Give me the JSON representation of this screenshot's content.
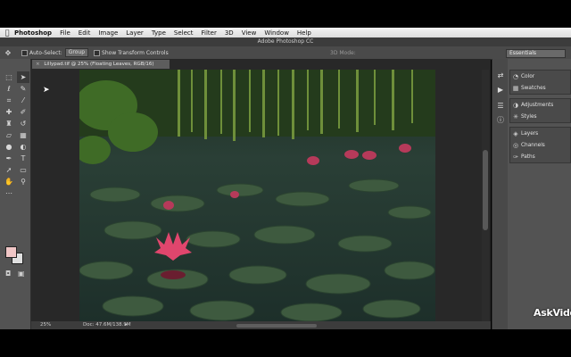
{
  "menubar": {
    "apple": "",
    "items": [
      "Photoshop",
      "File",
      "Edit",
      "Image",
      "Layer",
      "Type",
      "Select",
      "Filter",
      "3D",
      "View",
      "Window",
      "Help"
    ]
  },
  "app_title": "Adobe Photoshop CC",
  "options_bar": {
    "auto_select_label": "Auto-Select:",
    "auto_select_value": "Group",
    "show_transform_label": "Show Transform Controls",
    "mode_3d_label": "3D Mode:",
    "workspace": "Essentials"
  },
  "document_tab": {
    "title": "Lillypad.tif @ 25% (Floating Leaves, RGB/16)",
    "close_glyph": "×"
  },
  "status_bar": {
    "zoom": "25%",
    "doc_size": "Doc: 47.6M/138.9M",
    "arrow": "▸"
  },
  "panels": {
    "group1": [
      "Color",
      "Swatches"
    ],
    "group2": [
      "Adjustments",
      "Styles"
    ],
    "group3": [
      "Layers",
      "Channels",
      "Paths"
    ]
  },
  "tools": [
    "move-tool",
    "artboard-tool",
    "marquee-tool",
    "lasso-tool",
    "quick-select-tool",
    "crop-tool",
    "eyedropper-tool",
    "spot-heal-tool",
    "brush-tool",
    "clone-stamp-tool",
    "history-brush-tool",
    "eraser-tool",
    "gradient-tool",
    "blur-tool",
    "dodge-tool",
    "pen-tool",
    "type-tool",
    "path-select-tool",
    "shape-tool",
    "hand-tool",
    "zoom-tool",
    "extra-tool"
  ],
  "colors": {
    "foreground": "#f0c6c6",
    "background": "#e0e0e0",
    "ui_dark": "#535353"
  },
  "watermark": "AskVideo"
}
